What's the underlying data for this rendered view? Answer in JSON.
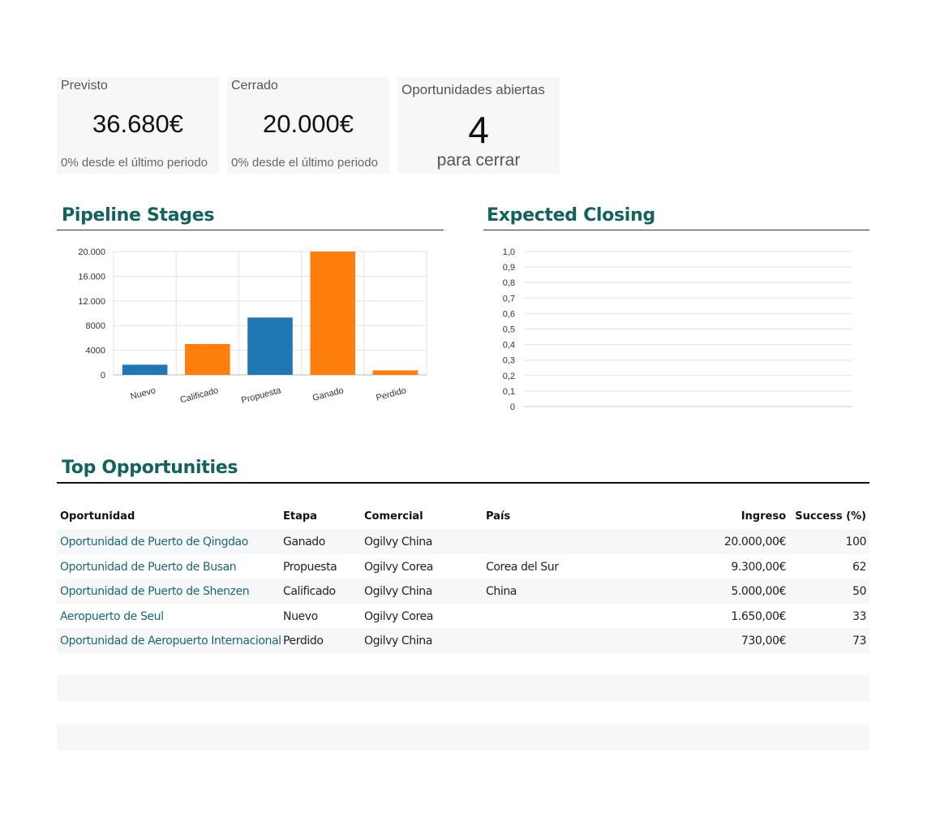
{
  "kpis": {
    "forecast": {
      "title": "Previsto",
      "value": "36.680€",
      "sub": "0% desde el último periodo"
    },
    "closed": {
      "title": "Cerrado",
      "value": "20.000€",
      "sub": "0% desde el último periodo"
    },
    "open": {
      "title": "Oportunidades abiertas",
      "value": "4",
      "sub": "para cerrar"
    }
  },
  "sections": {
    "pipeline": "Pipeline Stages",
    "closing": "Expected Closing",
    "top": "Top Opportunities"
  },
  "colors": {
    "blue": "#1f77b4",
    "orange": "#ff7f0e",
    "accent": "#12625e"
  },
  "chart_data": [
    {
      "type": "bar",
      "title": "",
      "categories": [
        "Nuevo",
        "Calificado",
        "Propuesta",
        "Ganado",
        "Perdido"
      ],
      "values": [
        1650,
        5000,
        9300,
        20000,
        730
      ],
      "bar_colors": [
        "#1f77b4",
        "#ff7f0e",
        "#1f77b4",
        "#ff7f0e",
        "#ff7f0e"
      ],
      "y_ticks": [
        "0",
        "4000",
        "8000",
        "12.000",
        "16.000",
        "20.000"
      ],
      "ylim": [
        0,
        20000
      ],
      "grid": true,
      "legend": "none"
    },
    {
      "type": "line",
      "title": "",
      "series": [],
      "y_ticks": [
        "0",
        "0,1",
        "0,2",
        "0,3",
        "0,4",
        "0,5",
        "0,6",
        "0,7",
        "0,8",
        "0,9",
        "1,0"
      ],
      "ylim": [
        0,
        1
      ],
      "grid": true,
      "legend": "none"
    }
  ],
  "table": {
    "headers": {
      "opportunity": "Oportunidad",
      "stage": "Etapa",
      "salesperson": "Comercial",
      "country": "País",
      "revenue": "Ingreso",
      "success": "Success (%)"
    },
    "rows": [
      {
        "opportunity": "Oportunidad de Puerto de Qingdao",
        "stage": "Ganado",
        "salesperson": "Ogilvy China",
        "country": "",
        "revenue": "20.000,00€",
        "success": "100"
      },
      {
        "opportunity": "Oportunidad de Puerto de Busan",
        "stage": "Propuesta",
        "salesperson": "Ogilvy Corea",
        "country": "Corea del Sur",
        "revenue": "9.300,00€",
        "success": "62"
      },
      {
        "opportunity": "Oportunidad de Puerto de Shenzen",
        "stage": "Calificado",
        "salesperson": "Ogilvy China",
        "country": "China",
        "revenue": "5.000,00€",
        "success": "50"
      },
      {
        "opportunity": "Aeropuerto de Seul",
        "stage": "Nuevo",
        "salesperson": "Ogilvy Corea",
        "country": "",
        "revenue": "1.650,00€",
        "success": "33"
      },
      {
        "opportunity": "Oportunidad de Aeropuerto Internacional de",
        "stage": "Perdido",
        "salesperson": "Ogilvy China",
        "country": "",
        "revenue": "730,00€",
        "success": "73"
      }
    ]
  }
}
